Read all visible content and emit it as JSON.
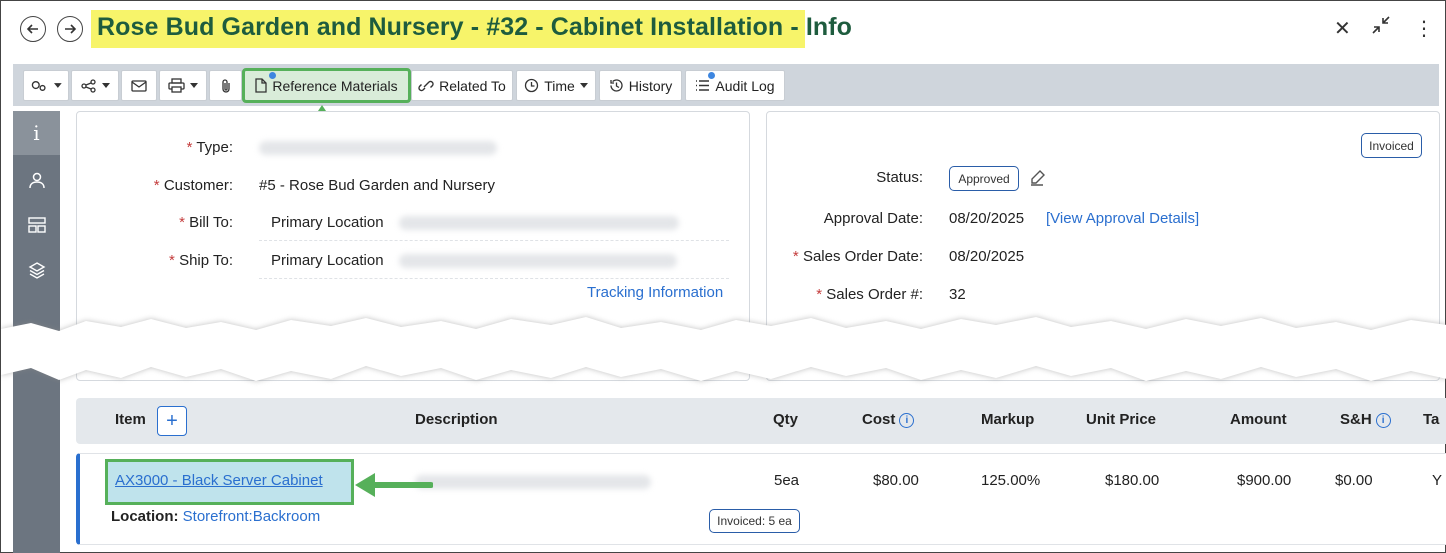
{
  "header": {
    "title": "Rose Bud Garden and Nursery - #32 - Cabinet Installation - Info",
    "back_icon": "arrow-left-circle-icon",
    "forward_icon": "arrow-right-circle-icon",
    "close_glyph": "✕",
    "collapse_glyph": "⤡",
    "more_glyph": "⋮"
  },
  "toolbar": {
    "reference_materials": "Reference Materials",
    "related_to": "Related To",
    "time": "Time",
    "history": "History",
    "audit_log": "Audit Log"
  },
  "rail": {
    "info_glyph": "i"
  },
  "details": {
    "type_label": "Type:",
    "customer_label": "Customer:",
    "customer_value": "#5 - Rose Bud Garden and Nursery",
    "bill_to_label": "Bill To:",
    "bill_to_value": "Primary Location",
    "ship_to_label": "Ship To:",
    "ship_to_value": "Primary Location",
    "tracking_link": "Tracking Information",
    "required_mark": "*"
  },
  "status_panel": {
    "invoiced_badge": "Invoiced",
    "status_label": "Status:",
    "status_value": "Approved",
    "approval_date_label": "Approval Date:",
    "approval_date_value": "08/20/2025",
    "view_approval_link": "[View Approval Details]",
    "sales_order_date_label": "Sales Order Date:",
    "sales_order_date_value": "08/20/2025",
    "sales_order_num_label": "Sales Order #:",
    "sales_order_num_value": "32"
  },
  "table": {
    "headers": {
      "item": "Item",
      "description": "Description",
      "qty": "Qty",
      "cost": "Cost",
      "markup": "Markup",
      "unit_price": "Unit Price",
      "amount": "Amount",
      "sh": "S&H",
      "tax": "Ta"
    },
    "add_glyph": "+",
    "info_glyph": "i",
    "rows": [
      {
        "item": "AX3000 - Black Server Cabinet",
        "location_label": "Location:",
        "location_value": "Storefront:Backroom",
        "qty": "5ea",
        "invoiced_badge": "Invoiced: 5 ea",
        "cost": "$80.00",
        "markup": "125.00%",
        "unit_price": "$180.00",
        "amount": "$900.00",
        "sh": "$0.00",
        "tax": "Y"
      }
    ]
  },
  "colors": {
    "title_highlight": "#f7f46a",
    "title_text": "#1e5c3e",
    "callout_green": "#56b05a",
    "link_blue": "#2a6fcf",
    "required_red": "#c43c3c"
  }
}
